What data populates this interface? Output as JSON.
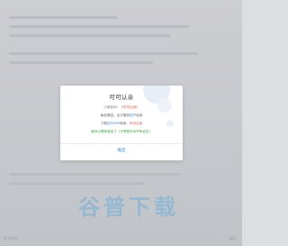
{
  "background": {
    "footer_left": "更多推荐",
    "footer_right": "随机"
  },
  "dialog": {
    "title": "可可认亲",
    "book_label": "小说名叫：",
    "book_name": "《可可认亲》",
    "reason_prefix": "版权原因，全文需到",
    "app_name_1": "知乎",
    "reason_suffix": "阅读",
    "download_prefix": "下载",
    "app_name_2": "知乎APP",
    "download_mid": "搜索：",
    "search_term": "可可认亲",
    "note": "我可以帮你收全了（只有知乎APP有全文）",
    "confirm": "确定"
  },
  "watermark": {
    "text": "谷普下载"
  },
  "colors": {
    "accent_blue": "#3d8fd6",
    "accent_red": "#e0453a",
    "accent_green": "#2c9a3c"
  }
}
